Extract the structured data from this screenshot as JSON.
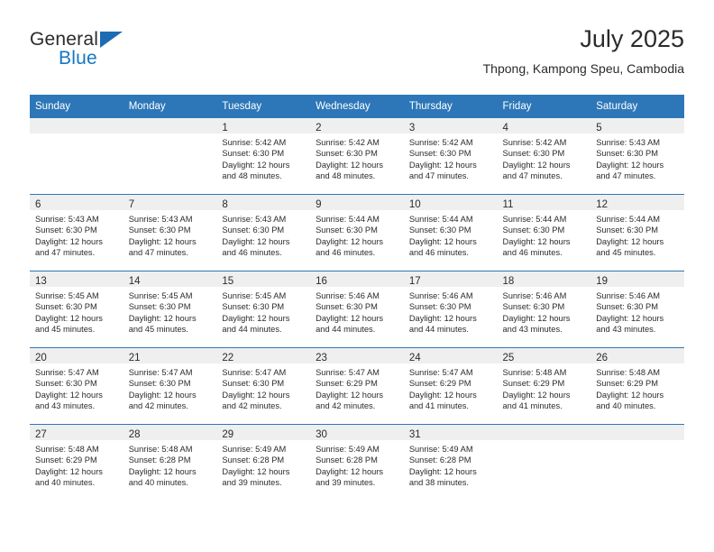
{
  "brand": {
    "name_part1": "General",
    "name_part2": "Blue",
    "triangle_icon": "triangle-icon",
    "accent_color": "#1577c4",
    "triangle_color": "#1d6cb3"
  },
  "header": {
    "title": "July 2025",
    "subtitle": "Thpong, Kampong Speu, Cambodia"
  },
  "theme": {
    "header_bg": "#2d77b8",
    "daynum_bg": "#efefef",
    "text": "#2b2b2b",
    "rule": "#2d77b8"
  },
  "weekday_headers": [
    "Sunday",
    "Monday",
    "Tuesday",
    "Wednesday",
    "Thursday",
    "Friday",
    "Saturday"
  ],
  "weeks": [
    [
      {
        "day": "",
        "empty": true,
        "sunrise": "",
        "sunset": "",
        "daylight_1": "",
        "daylight_2": ""
      },
      {
        "day": "",
        "empty": true,
        "sunrise": "",
        "sunset": "",
        "daylight_1": "",
        "daylight_2": ""
      },
      {
        "day": "1",
        "empty": false,
        "sunrise": "Sunrise: 5:42 AM",
        "sunset": "Sunset: 6:30 PM",
        "daylight_1": "Daylight: 12 hours",
        "daylight_2": "and 48 minutes."
      },
      {
        "day": "2",
        "empty": false,
        "sunrise": "Sunrise: 5:42 AM",
        "sunset": "Sunset: 6:30 PM",
        "daylight_1": "Daylight: 12 hours",
        "daylight_2": "and 48 minutes."
      },
      {
        "day": "3",
        "empty": false,
        "sunrise": "Sunrise: 5:42 AM",
        "sunset": "Sunset: 6:30 PM",
        "daylight_1": "Daylight: 12 hours",
        "daylight_2": "and 47 minutes."
      },
      {
        "day": "4",
        "empty": false,
        "sunrise": "Sunrise: 5:42 AM",
        "sunset": "Sunset: 6:30 PM",
        "daylight_1": "Daylight: 12 hours",
        "daylight_2": "and 47 minutes."
      },
      {
        "day": "5",
        "empty": false,
        "sunrise": "Sunrise: 5:43 AM",
        "sunset": "Sunset: 6:30 PM",
        "daylight_1": "Daylight: 12 hours",
        "daylight_2": "and 47 minutes."
      }
    ],
    [
      {
        "day": "6",
        "empty": false,
        "sunrise": "Sunrise: 5:43 AM",
        "sunset": "Sunset: 6:30 PM",
        "daylight_1": "Daylight: 12 hours",
        "daylight_2": "and 47 minutes."
      },
      {
        "day": "7",
        "empty": false,
        "sunrise": "Sunrise: 5:43 AM",
        "sunset": "Sunset: 6:30 PM",
        "daylight_1": "Daylight: 12 hours",
        "daylight_2": "and 47 minutes."
      },
      {
        "day": "8",
        "empty": false,
        "sunrise": "Sunrise: 5:43 AM",
        "sunset": "Sunset: 6:30 PM",
        "daylight_1": "Daylight: 12 hours",
        "daylight_2": "and 46 minutes."
      },
      {
        "day": "9",
        "empty": false,
        "sunrise": "Sunrise: 5:44 AM",
        "sunset": "Sunset: 6:30 PM",
        "daylight_1": "Daylight: 12 hours",
        "daylight_2": "and 46 minutes."
      },
      {
        "day": "10",
        "empty": false,
        "sunrise": "Sunrise: 5:44 AM",
        "sunset": "Sunset: 6:30 PM",
        "daylight_1": "Daylight: 12 hours",
        "daylight_2": "and 46 minutes."
      },
      {
        "day": "11",
        "empty": false,
        "sunrise": "Sunrise: 5:44 AM",
        "sunset": "Sunset: 6:30 PM",
        "daylight_1": "Daylight: 12 hours",
        "daylight_2": "and 46 minutes."
      },
      {
        "day": "12",
        "empty": false,
        "sunrise": "Sunrise: 5:44 AM",
        "sunset": "Sunset: 6:30 PM",
        "daylight_1": "Daylight: 12 hours",
        "daylight_2": "and 45 minutes."
      }
    ],
    [
      {
        "day": "13",
        "empty": false,
        "sunrise": "Sunrise: 5:45 AM",
        "sunset": "Sunset: 6:30 PM",
        "daylight_1": "Daylight: 12 hours",
        "daylight_2": "and 45 minutes."
      },
      {
        "day": "14",
        "empty": false,
        "sunrise": "Sunrise: 5:45 AM",
        "sunset": "Sunset: 6:30 PM",
        "daylight_1": "Daylight: 12 hours",
        "daylight_2": "and 45 minutes."
      },
      {
        "day": "15",
        "empty": false,
        "sunrise": "Sunrise: 5:45 AM",
        "sunset": "Sunset: 6:30 PM",
        "daylight_1": "Daylight: 12 hours",
        "daylight_2": "and 44 minutes."
      },
      {
        "day": "16",
        "empty": false,
        "sunrise": "Sunrise: 5:46 AM",
        "sunset": "Sunset: 6:30 PM",
        "daylight_1": "Daylight: 12 hours",
        "daylight_2": "and 44 minutes."
      },
      {
        "day": "17",
        "empty": false,
        "sunrise": "Sunrise: 5:46 AM",
        "sunset": "Sunset: 6:30 PM",
        "daylight_1": "Daylight: 12 hours",
        "daylight_2": "and 44 minutes."
      },
      {
        "day": "18",
        "empty": false,
        "sunrise": "Sunrise: 5:46 AM",
        "sunset": "Sunset: 6:30 PM",
        "daylight_1": "Daylight: 12 hours",
        "daylight_2": "and 43 minutes."
      },
      {
        "day": "19",
        "empty": false,
        "sunrise": "Sunrise: 5:46 AM",
        "sunset": "Sunset: 6:30 PM",
        "daylight_1": "Daylight: 12 hours",
        "daylight_2": "and 43 minutes."
      }
    ],
    [
      {
        "day": "20",
        "empty": false,
        "sunrise": "Sunrise: 5:47 AM",
        "sunset": "Sunset: 6:30 PM",
        "daylight_1": "Daylight: 12 hours",
        "daylight_2": "and 43 minutes."
      },
      {
        "day": "21",
        "empty": false,
        "sunrise": "Sunrise: 5:47 AM",
        "sunset": "Sunset: 6:30 PM",
        "daylight_1": "Daylight: 12 hours",
        "daylight_2": "and 42 minutes."
      },
      {
        "day": "22",
        "empty": false,
        "sunrise": "Sunrise: 5:47 AM",
        "sunset": "Sunset: 6:30 PM",
        "daylight_1": "Daylight: 12 hours",
        "daylight_2": "and 42 minutes."
      },
      {
        "day": "23",
        "empty": false,
        "sunrise": "Sunrise: 5:47 AM",
        "sunset": "Sunset: 6:29 PM",
        "daylight_1": "Daylight: 12 hours",
        "daylight_2": "and 42 minutes."
      },
      {
        "day": "24",
        "empty": false,
        "sunrise": "Sunrise: 5:47 AM",
        "sunset": "Sunset: 6:29 PM",
        "daylight_1": "Daylight: 12 hours",
        "daylight_2": "and 41 minutes."
      },
      {
        "day": "25",
        "empty": false,
        "sunrise": "Sunrise: 5:48 AM",
        "sunset": "Sunset: 6:29 PM",
        "daylight_1": "Daylight: 12 hours",
        "daylight_2": "and 41 minutes."
      },
      {
        "day": "26",
        "empty": false,
        "sunrise": "Sunrise: 5:48 AM",
        "sunset": "Sunset: 6:29 PM",
        "daylight_1": "Daylight: 12 hours",
        "daylight_2": "and 40 minutes."
      }
    ],
    [
      {
        "day": "27",
        "empty": false,
        "sunrise": "Sunrise: 5:48 AM",
        "sunset": "Sunset: 6:29 PM",
        "daylight_1": "Daylight: 12 hours",
        "daylight_2": "and 40 minutes."
      },
      {
        "day": "28",
        "empty": false,
        "sunrise": "Sunrise: 5:48 AM",
        "sunset": "Sunset: 6:28 PM",
        "daylight_1": "Daylight: 12 hours",
        "daylight_2": "and 40 minutes."
      },
      {
        "day": "29",
        "empty": false,
        "sunrise": "Sunrise: 5:49 AM",
        "sunset": "Sunset: 6:28 PM",
        "daylight_1": "Daylight: 12 hours",
        "daylight_2": "and 39 minutes."
      },
      {
        "day": "30",
        "empty": false,
        "sunrise": "Sunrise: 5:49 AM",
        "sunset": "Sunset: 6:28 PM",
        "daylight_1": "Daylight: 12 hours",
        "daylight_2": "and 39 minutes."
      },
      {
        "day": "31",
        "empty": false,
        "sunrise": "Sunrise: 5:49 AM",
        "sunset": "Sunset: 6:28 PM",
        "daylight_1": "Daylight: 12 hours",
        "daylight_2": "and 38 minutes."
      },
      {
        "day": "",
        "empty": true,
        "sunrise": "",
        "sunset": "",
        "daylight_1": "",
        "daylight_2": ""
      },
      {
        "day": "",
        "empty": true,
        "sunrise": "",
        "sunset": "",
        "daylight_1": "",
        "daylight_2": ""
      }
    ]
  ]
}
